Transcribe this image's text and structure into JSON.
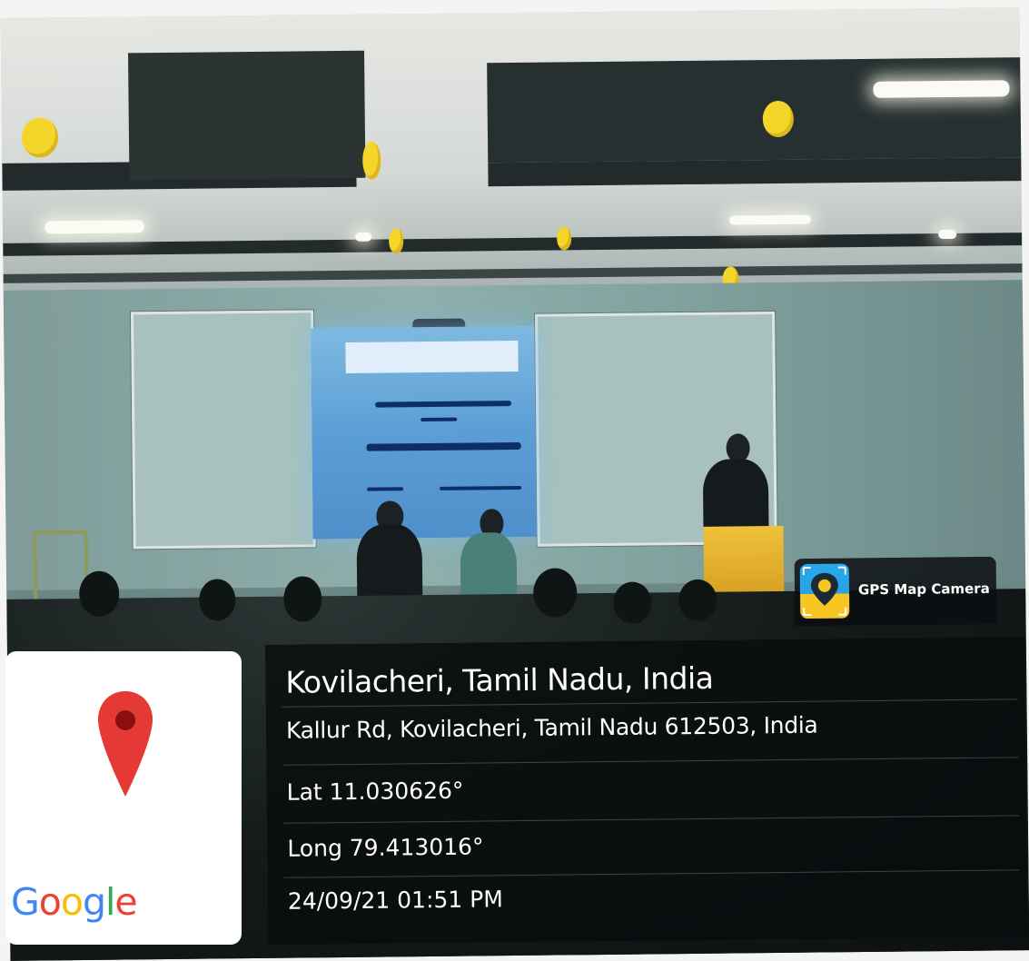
{
  "badge": {
    "label": "GPS Map Camera"
  },
  "map_card": {
    "brand": [
      "G",
      "o",
      "o",
      "g",
      "l",
      "e"
    ],
    "brand_colors": [
      "#4285F4",
      "#EA4335",
      "#FBBC05",
      "#4285F4",
      "#34A853",
      "#EA4335"
    ],
    "pin_color": "#E53935"
  },
  "location": {
    "title": "Kovilacheri, Tamil Nadu, India",
    "address": "Kallur Rd, Kovilacheri, Tamil Nadu 612503, India",
    "latitude": "Lat 11.030626°",
    "longitude": "Long 79.413016°",
    "datetime": "24/09/21 01:51 PM"
  }
}
